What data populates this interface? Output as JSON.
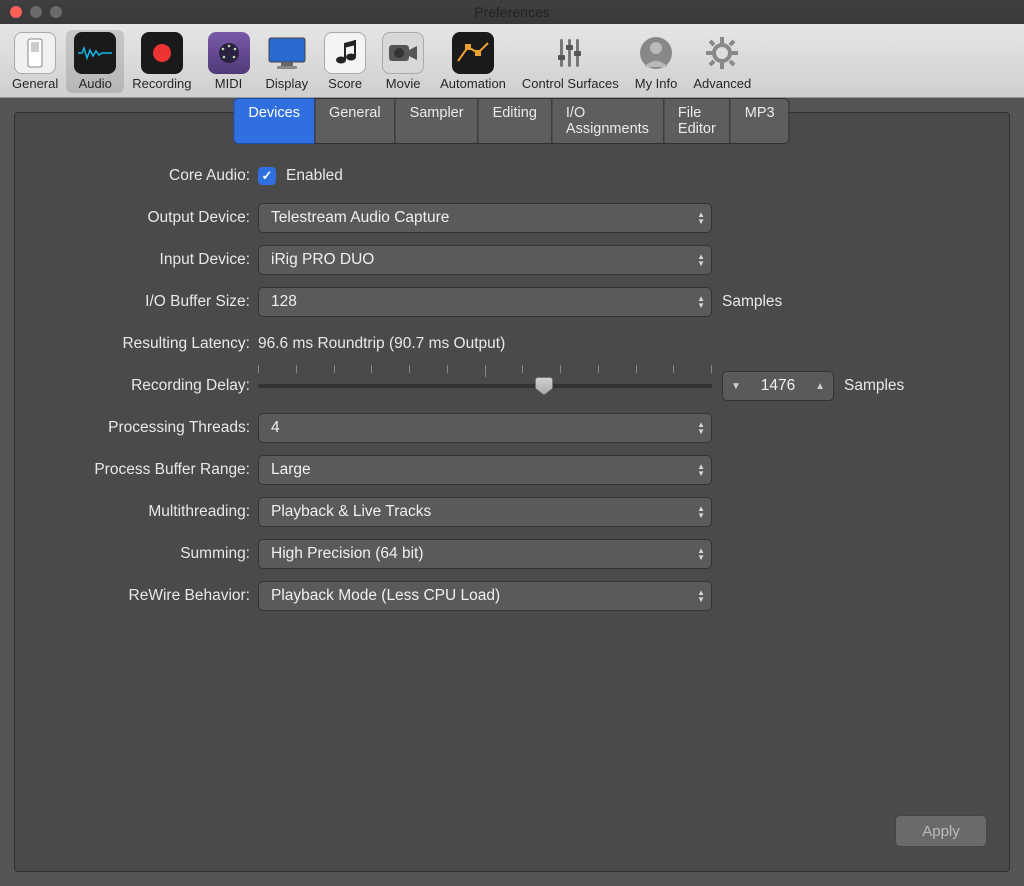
{
  "window": {
    "title": "Preferences"
  },
  "toolbar": {
    "items": [
      {
        "label": "General"
      },
      {
        "label": "Audio"
      },
      {
        "label": "Recording"
      },
      {
        "label": "MIDI"
      },
      {
        "label": "Display"
      },
      {
        "label": "Score"
      },
      {
        "label": "Movie"
      },
      {
        "label": "Automation"
      },
      {
        "label": "Control Surfaces"
      },
      {
        "label": "My Info"
      },
      {
        "label": "Advanced"
      }
    ],
    "selected": "Audio"
  },
  "tabs": {
    "items": [
      "Devices",
      "General",
      "Sampler",
      "Editing",
      "I/O Assignments",
      "File Editor",
      "MP3"
    ],
    "active": "Devices"
  },
  "labels": {
    "core_audio": "Core Audio:",
    "enabled": "Enabled",
    "output_device": "Output Device:",
    "input_device": "Input Device:",
    "io_buffer": "I/O Buffer Size:",
    "samples": "Samples",
    "resulting_latency": "Resulting Latency:",
    "recording_delay": "Recording Delay:",
    "processing_threads": "Processing Threads:",
    "process_buffer": "Process Buffer Range:",
    "multithreading": "Multithreading:",
    "summing": "Summing:",
    "rewire": "ReWire Behavior:",
    "apply": "Apply"
  },
  "values": {
    "output_device": "Telestream Audio Capture",
    "input_device": "iRig PRO DUO",
    "io_buffer": "128",
    "resulting_latency": "96.6 ms Roundtrip (90.7 ms Output)",
    "recording_delay": "1476",
    "recording_delay_fraction": 0.63,
    "processing_threads": "4",
    "process_buffer": "Large",
    "multithreading": "Playback & Live Tracks",
    "summing": "High Precision (64 bit)",
    "rewire": "Playback Mode (Less CPU Load)"
  },
  "icons": {
    "general_bg": "#f0f0f0",
    "audio_bg": "#1a1a1a",
    "recording_bg": "#1a1a1a",
    "midi_bg": "#6a4a9a",
    "display_bg": "#2a6ad0",
    "score_bg": "#f4f4f4",
    "movie_bg": "#d8d8d8",
    "automation_bg": "#1a1a1a",
    "surfaces_bg": "#888",
    "myinfo_bg": "#888",
    "advanced_bg": "#888"
  }
}
